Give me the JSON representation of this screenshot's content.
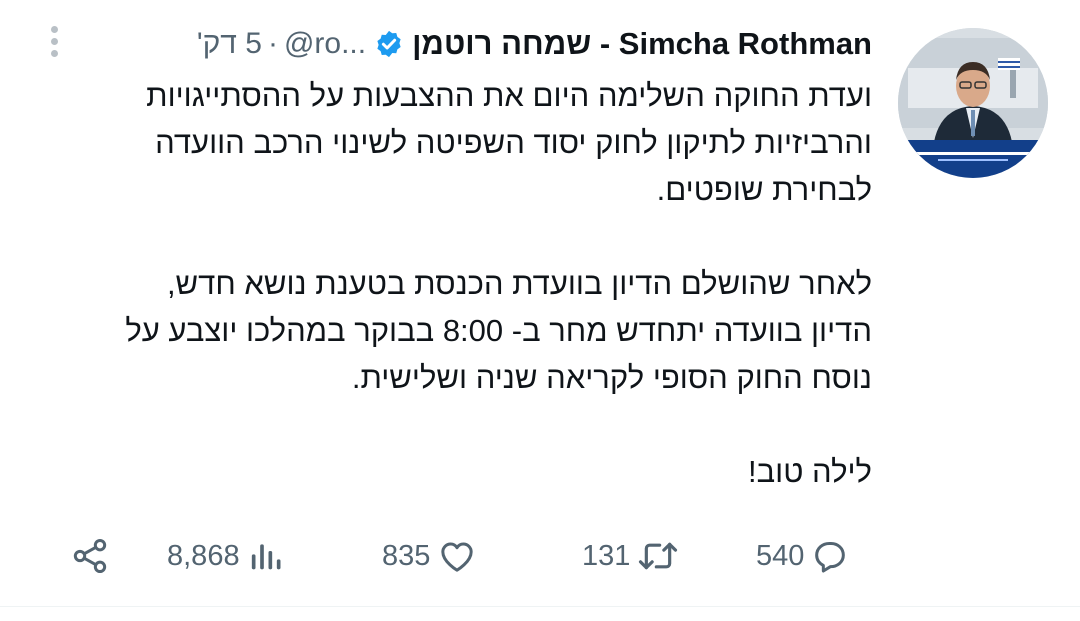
{
  "author": {
    "display_name": "שמחה רוטמן - Simcha Rothman",
    "handle": "@ro...",
    "time_ago": "5 דק'",
    "separator": "·"
  },
  "tweet": {
    "paragraphs": [
      [
        "ועדת החוקה השלימה היום את ההצבעות על ההסתייגויות",
        "והרביזיות לתיקון לחוק יסוד השפיטה לשינוי הרכב הוועדה",
        "לבחירת שופטים."
      ],
      [
        "לאחר שהושלם הדיון בוועדת הכנסת בטענת נושא חדש,",
        "הדיון בוועדה יתחדש מחר ב- 8:00 בבוקר במהלכו יוצבע על",
        "נוסח החוק הסופי לקריאה שניה ושלישית."
      ],
      [
        "לילה טוב!"
      ]
    ]
  },
  "metrics": {
    "replies": "540",
    "retweets": "131",
    "likes": "835",
    "views": "8,868"
  },
  "icons": {
    "verified": "verified-badge-icon",
    "more": "more-options-icon",
    "reply": "reply-icon",
    "retweet": "retweet-icon",
    "like": "heart-icon",
    "views": "views-chart-icon",
    "share": "share-icon"
  },
  "colors": {
    "text": "#0f1419",
    "muted": "#536471",
    "verified": "#1d9bf0"
  }
}
